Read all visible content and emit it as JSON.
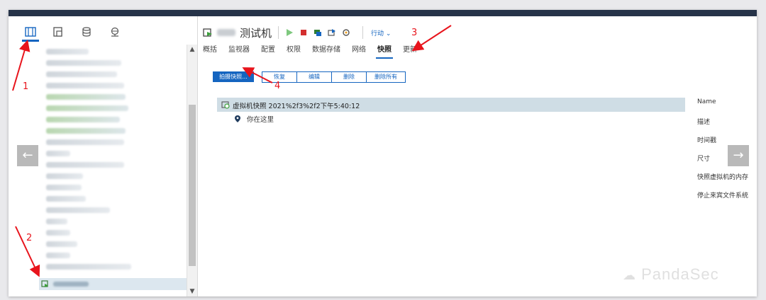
{
  "nav": {
    "tabs": [
      {
        "name": "hosts-and-clusters-icon"
      },
      {
        "name": "vms-and-templates-icon"
      },
      {
        "name": "storage-icon"
      },
      {
        "name": "networking-icon"
      }
    ]
  },
  "header": {
    "title": "测试机",
    "actions_label": "行动"
  },
  "tabs": [
    "概括",
    "监视器",
    "配置",
    "权限",
    "数据存储",
    "网络",
    "快照",
    "更新"
  ],
  "active_tab": "快照",
  "buttons": {
    "take_snapshot": "拍摄快照...",
    "revert": "恢复",
    "edit": "编辑",
    "delete": "删除",
    "delete_all": "删除所有"
  },
  "snapshot_tree": {
    "snapshot_name": "虚拟机快照 2021%2f3%2f2下午5:40:12",
    "you_are_here": "你在这里"
  },
  "properties": [
    "Name",
    "描述",
    "时间戳",
    "尺寸",
    "快照虚拟机的内存",
    "停止来宾文件系统"
  ],
  "annotations": [
    "1",
    "2",
    "3",
    "4"
  ],
  "watermark": "PandaSec",
  "colors": {
    "accent": "#1565c0",
    "header_bar": "#263349",
    "arrow": "#e8141c",
    "selected_row": "#cfdde5"
  }
}
